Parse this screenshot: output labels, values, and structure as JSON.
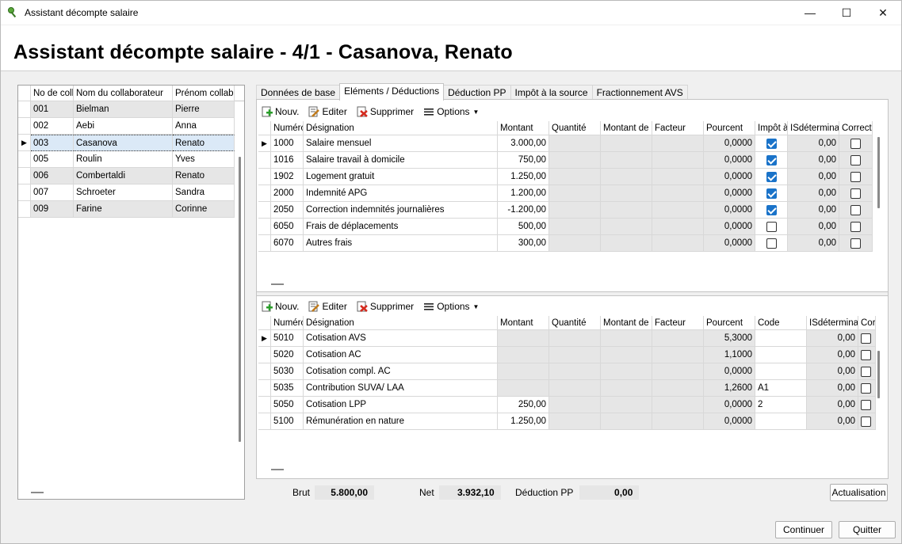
{
  "window": {
    "title": "Assistant décompte salaire",
    "minimize": "—",
    "maximize": "☐",
    "close": "✕"
  },
  "header": {
    "title": "Assistant décompte salaire - 4/1 - Casanova, Renato"
  },
  "employees": {
    "columns": [
      "No de colla",
      "Nom du collaborateur",
      "Prénom collabor"
    ],
    "rows": [
      {
        "no": "001",
        "nom": "Bielman",
        "prenom": "Pierre"
      },
      {
        "no": "002",
        "nom": "Aebi",
        "prenom": "Anna"
      },
      {
        "no": "003",
        "nom": "Casanova",
        "prenom": "Renato"
      },
      {
        "no": "005",
        "nom": "Roulin",
        "prenom": "Yves"
      },
      {
        "no": "006",
        "nom": "Combertaldi",
        "prenom": "Renato"
      },
      {
        "no": "007",
        "nom": "Schroeter",
        "prenom": "Sandra"
      },
      {
        "no": "009",
        "nom": "Farine",
        "prenom": "Corinne"
      }
    ],
    "selected_index": 2
  },
  "tabs": [
    "Données de base",
    "Eléments / Déductions",
    "Déduction PP",
    "Impôt à la source",
    "Fractionnement AVS"
  ],
  "active_tab": 1,
  "toolbar": {
    "new": "Nouv.",
    "edit": "Editer",
    "delete": "Supprimer",
    "options": "Options"
  },
  "elements": {
    "columns": [
      "Numéro",
      "Désignation",
      "Montant",
      "Quantité",
      "Montant de b",
      "Facteur",
      "Pourcent",
      "Impôt à",
      "ISdéterminan",
      "Correction"
    ],
    "rows": [
      {
        "num": "1000",
        "des": "Salaire mensuel",
        "montant": "3.000,00",
        "pourcent": "0,0000",
        "impot": true,
        "isdet": "0,00",
        "corr": false
      },
      {
        "num": "1016",
        "des": "Salaire travail à domicile",
        "montant": "750,00",
        "pourcent": "0,0000",
        "impot": true,
        "isdet": "0,00",
        "corr": false
      },
      {
        "num": "1902",
        "des": "Logement gratuit",
        "montant": "1.250,00",
        "pourcent": "0,0000",
        "impot": true,
        "isdet": "0,00",
        "corr": false
      },
      {
        "num": "2000",
        "des": "Indemnité APG",
        "montant": "1.200,00",
        "pourcent": "0,0000",
        "impot": true,
        "isdet": "0,00",
        "corr": false
      },
      {
        "num": "2050",
        "des": "Correction indemnités journalières",
        "montant": "-1.200,00",
        "pourcent": "0,0000",
        "impot": true,
        "isdet": "0,00",
        "corr": false
      },
      {
        "num": "6050",
        "des": "Frais de déplacements",
        "montant": "500,00",
        "pourcent": "0,0000",
        "impot": false,
        "isdet": "0,00",
        "corr": false
      },
      {
        "num": "6070",
        "des": "Autres frais",
        "montant": "300,00",
        "pourcent": "0,0000",
        "impot": false,
        "isdet": "0,00",
        "corr": false
      }
    ]
  },
  "deductions": {
    "columns": [
      "Numéro",
      "Désignation",
      "Montant",
      "Quantité",
      "Montant de b",
      "Facteur",
      "Pourcent",
      "Code",
      "ISdéterminan",
      "Cor"
    ],
    "rows": [
      {
        "num": "5010",
        "des": "Cotisation AVS",
        "montant": "",
        "pourcent": "5,3000",
        "code": "",
        "isdet": "0,00"
      },
      {
        "num": "5020",
        "des": "Cotisation AC",
        "montant": "",
        "pourcent": "1,1000",
        "code": "",
        "isdet": "0,00"
      },
      {
        "num": "5030",
        "des": "Cotisation compl. AC",
        "montant": "",
        "pourcent": "0,0000",
        "code": "",
        "isdet": "0,00"
      },
      {
        "num": "5035",
        "des": "Contribution SUVA/ LAA",
        "montant": "",
        "pourcent": "1,2600",
        "code": "A1",
        "isdet": "0,00"
      },
      {
        "num": "5050",
        "des": "Cotisation LPP",
        "montant": "250,00",
        "pourcent": "0,0000",
        "code": "2",
        "isdet": "0,00"
      },
      {
        "num": "5100",
        "des": "Rémunération en nature",
        "montant": "1.250,00",
        "pourcent": "0,0000",
        "code": "",
        "isdet": "0,00"
      }
    ]
  },
  "totals": {
    "brut_label": "Brut",
    "brut": "5.800,00",
    "net_label": "Net",
    "net": "3.932,10",
    "pp_label": "Déduction PP",
    "pp": "0,00"
  },
  "buttons": {
    "refresh": "Actualisation",
    "continue": "Continuer",
    "quit": "Quitter"
  }
}
